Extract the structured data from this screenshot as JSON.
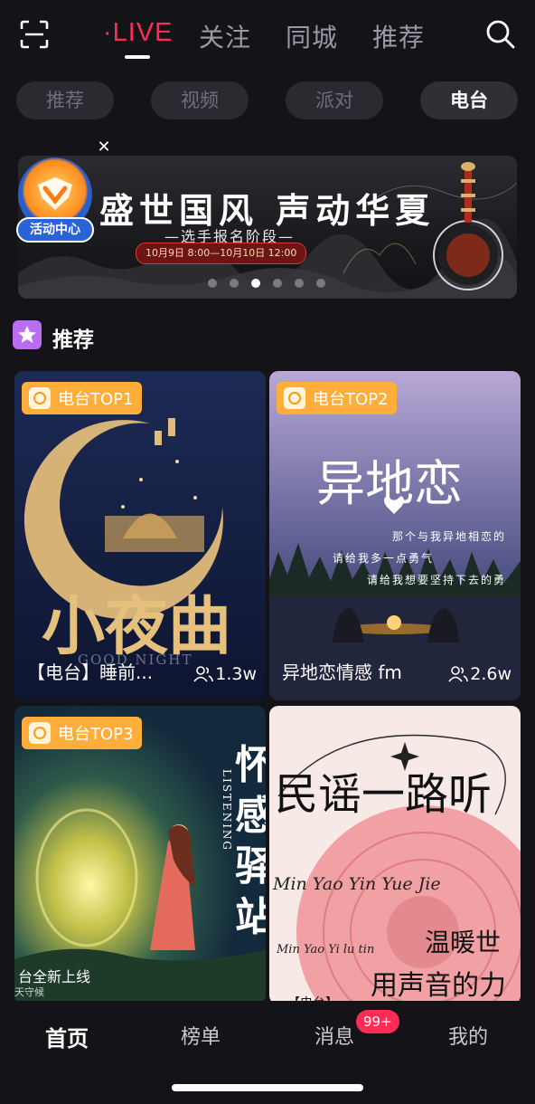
{
  "top_nav": {
    "tabs": [
      {
        "label": "·LIVE",
        "active": true
      },
      {
        "label": "关注",
        "active": false
      },
      {
        "label": "同城",
        "active": false
      },
      {
        "label": "推荐",
        "active": false
      }
    ],
    "scan_icon": "scan-icon",
    "search_icon": "search-icon",
    "accent_color": "#ff2c55"
  },
  "chips": [
    {
      "label": "推荐",
      "active": false
    },
    {
      "label": "视频",
      "active": false
    },
    {
      "label": "派对",
      "active": false
    },
    {
      "label": "电台",
      "active": true
    }
  ],
  "banner": {
    "title": "盛世国风 声动华夏",
    "subtitle": "—选手报名阶段—",
    "date": "10月9日 8:00—10月10日 12:00",
    "activity_center_label": "活动中心",
    "close_icon": "close-icon",
    "dots_count": 6,
    "active_dot": 3
  },
  "section": {
    "title": "推荐",
    "icon": "star-icon"
  },
  "cards": [
    {
      "tag": "电台TOP1",
      "title": "【电台】睡前...",
      "listeners": "1.3w",
      "art_text": "小夜曲",
      "art_sub": "GOOD NIGHT"
    },
    {
      "tag": "电台TOP2",
      "title": "异地恋情感 fm",
      "listeners": "2.6w",
      "art_text": "异地恋",
      "art_lines": [
        "那个与我异地相恋的",
        "请给我多一点勇气",
        "请给我想要坚持下去的勇"
      ]
    },
    {
      "tag": "电台TOP3",
      "title": "",
      "listeners": "",
      "art_text": "怀感驿站",
      "art_sub": "LISTENING",
      "art_bottom": "台全新上线",
      "art_bottom2": "天守候"
    },
    {
      "tag": "",
      "title": "【电台】",
      "listeners": "",
      "art_text": "民谣一路听",
      "art_sub": "Min Yao Yin Yue Jie",
      "art_sub2": "Min Yao Yi lu tin",
      "art_bottom": "温暖世",
      "art_bottom2": "用声音的力"
    }
  ],
  "tab_bar": {
    "tabs": [
      {
        "label": "首页",
        "active": true
      },
      {
        "label": "榜单",
        "active": false
      },
      {
        "label": "消息",
        "active": false
      },
      {
        "label": "我的",
        "active": false
      }
    ],
    "message_badge": "99+"
  }
}
